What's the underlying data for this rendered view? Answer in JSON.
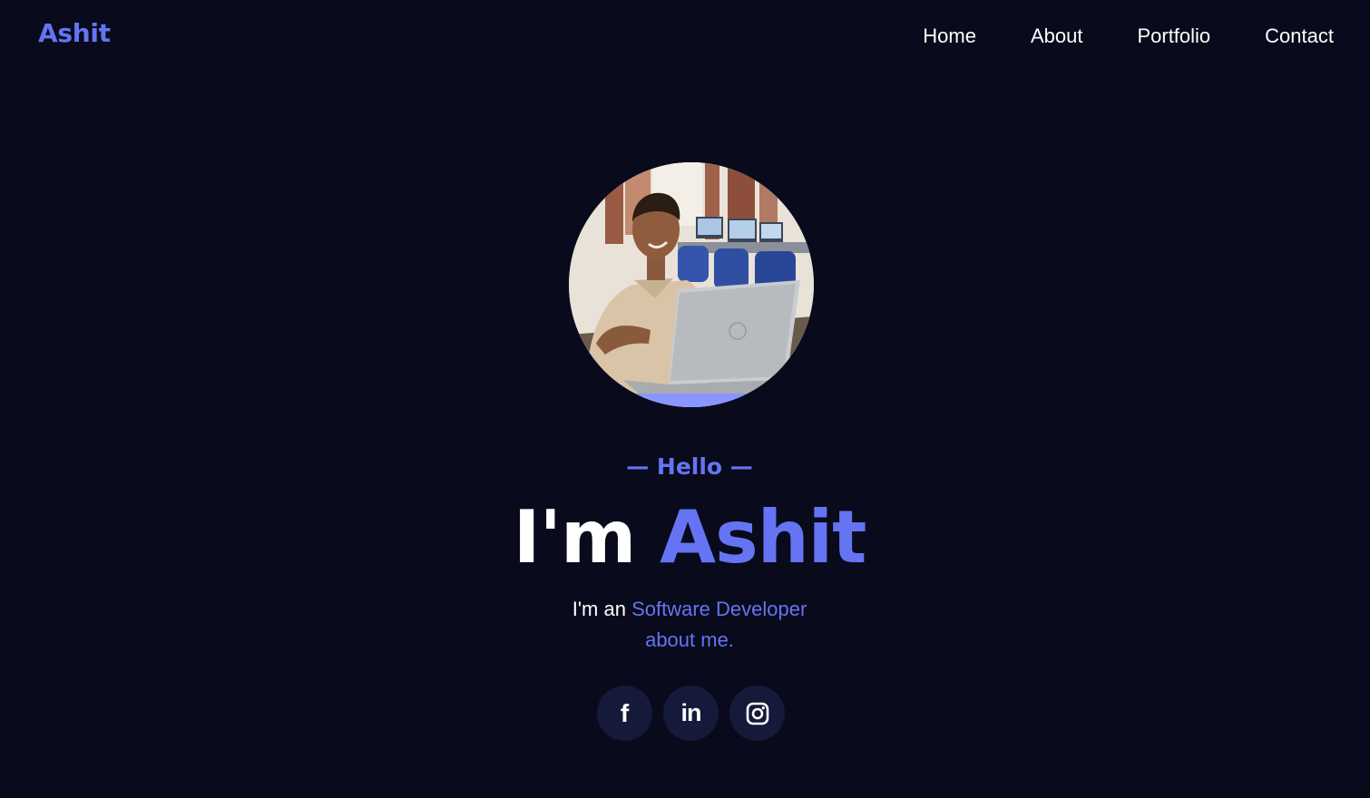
{
  "header": {
    "logo": "Ashit",
    "nav": [
      {
        "label": "Home"
      },
      {
        "label": "About"
      },
      {
        "label": "Portfolio"
      },
      {
        "label": "Contact"
      }
    ]
  },
  "hero": {
    "greeting": "— Hello —",
    "headline_prefix": "I'm ",
    "headline_name": "Ashit",
    "tagline_prefix": "I'm an ",
    "tagline_role": "Software Developer",
    "tagline_suffix": "about me."
  },
  "social": [
    {
      "icon": "facebook-icon"
    },
    {
      "icon": "linkedin-icon"
    },
    {
      "icon": "instagram-icon"
    }
  ],
  "colors": {
    "background": "#090a1b",
    "accent": "#6574f2",
    "social_button_bg": "#161a3a",
    "text": "#ffffff"
  }
}
